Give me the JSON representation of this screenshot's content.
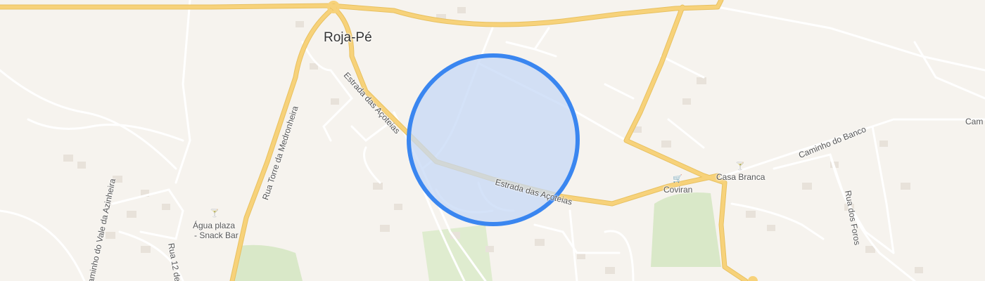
{
  "map": {
    "town": "Roja-Pé",
    "streets": {
      "estrada_left": "Estrada das Açoteias",
      "estrada_right": "Estrada das Açoteias",
      "rua_torre": "Rua Torre da Medronheira",
      "caminho_vale": "Caminho do Vale da Azinheira",
      "rua_12": "Rua 12 de",
      "caminho_banco": "Caminho do Banco",
      "rua_foros": "Rua dos Foros",
      "cam_edge": "Cam"
    },
    "pois": {
      "agua_plaza_1": "Água plaza",
      "agua_plaza_2": "- Snack Bar",
      "coviran": "Coviran",
      "casa_branca": "Casa Branca"
    },
    "colors": {
      "background": "#f6f3ee",
      "major_road": "#f7d27a",
      "minor_road": "#ffffff",
      "park": "#d9e8c8",
      "building": "#e8e2da",
      "radius_fill": "#c5d8f5",
      "radius_stroke": "#3a86f0"
    }
  }
}
